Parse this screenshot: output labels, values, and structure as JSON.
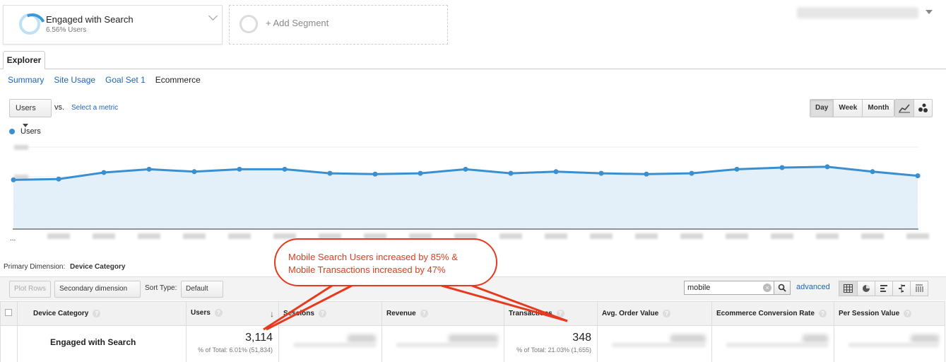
{
  "segments": [
    {
      "name": "Engaged with Search",
      "sub": "6.56% Users"
    },
    {
      "name": "+ Add Segment"
    }
  ],
  "explorer_tab": "Explorer",
  "subtabs": [
    "Summary",
    "Site Usage",
    "Goal Set 1",
    "Ecommerce"
  ],
  "metric": {
    "selected": "Users",
    "vs": "vs.",
    "select_link": "Select a metric"
  },
  "granularity": [
    "Day",
    "Week",
    "Month"
  ],
  "legend": {
    "label": "Users",
    "color": "#3a8fd0"
  },
  "chart_data": {
    "type": "area",
    "series": [
      {
        "name": "Users",
        "values": [
          0.6,
          0.61,
          0.69,
          0.73,
          0.7,
          0.73,
          0.73,
          0.68,
          0.67,
          0.68,
          0.73,
          0.68,
          0.7,
          0.68,
          0.67,
          0.68,
          0.73,
          0.75,
          0.76,
          0.7,
          0.65
        ]
      }
    ],
    "y_scale_note": "relative (axis labels obscured)",
    "first_x_label": "..."
  },
  "callout": {
    "line1": "Mobile Search Users increased by 85% &",
    "line2": "Mobile Transactions increased by 47%",
    "color": "#e53a1f"
  },
  "primary_dimension": {
    "label": "Primary Dimension:",
    "value": "Device Category"
  },
  "toolbar": {
    "plot_rows": "Plot Rows",
    "secondary_dimension": "Secondary dimension",
    "sort_type_label": "Sort Type:",
    "sort_type_value": "Default",
    "search_value": "mobile",
    "advanced": "advanced"
  },
  "table": {
    "headers": [
      "Device Category",
      "Users",
      "Sessions",
      "Revenue",
      "Transactions",
      "Avg. Order Value",
      "Ecommerce Conversion Rate",
      "Per Session Value"
    ],
    "row": {
      "name": "Engaged with Search",
      "users": "3,114",
      "users_pct": "% of Total: 6.01% (51,834)",
      "transactions": "348",
      "transactions_pct": "% of Total: 21.03% (1,655)"
    }
  }
}
